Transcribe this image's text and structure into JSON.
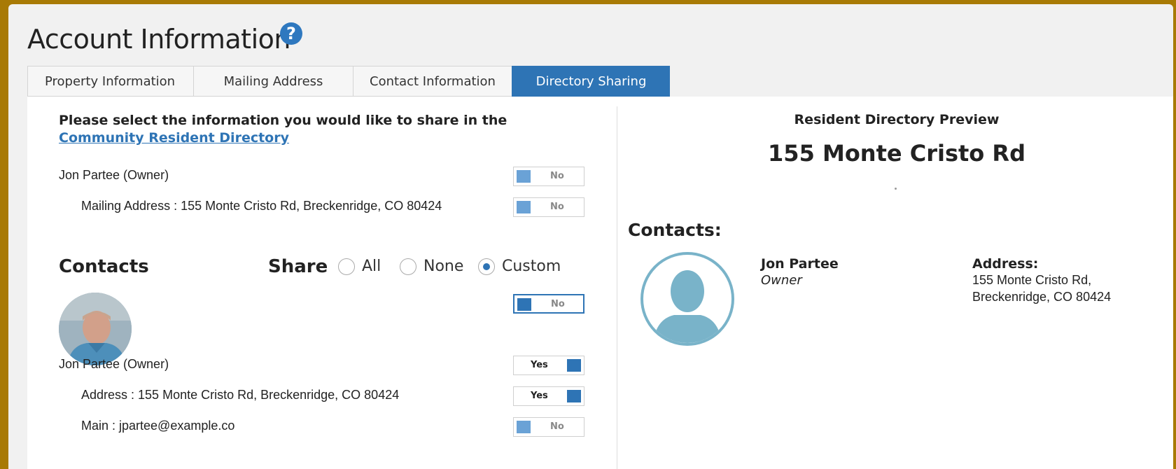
{
  "page": {
    "title": "Account Information",
    "help_icon": "?"
  },
  "tabs": [
    {
      "label": "Property Information",
      "active": false
    },
    {
      "label": "Mailing Address",
      "active": false
    },
    {
      "label": "Contact Information",
      "active": false
    },
    {
      "label": "Directory Sharing",
      "active": true
    }
  ],
  "left": {
    "intro_text": "Please select the information you would like to share in the ",
    "intro_link": "Community Resident Directory",
    "owner_row": {
      "label": "Jon Partee (Owner)",
      "toggle": "No"
    },
    "mailing_row": {
      "label": "Mailing Address : 155 Monte Cristo Rd, Breckenridge, CO 80424",
      "toggle": "No"
    },
    "contacts_heading": "Contacts",
    "share_heading": "Share",
    "share_options": [
      "All",
      "None",
      "Custom"
    ],
    "share_selected": "Custom",
    "photo_toggle": "No",
    "contact_rows": [
      {
        "label": "Jon Partee (Owner)",
        "toggle": "Yes"
      },
      {
        "label": "Address : 155 Monte Cristo Rd, Breckenridge, CO 80424",
        "toggle": "Yes"
      },
      {
        "label": "Main : jpartee@example.co",
        "toggle": "No"
      }
    ]
  },
  "preview": {
    "heading": "Resident Directory Preview",
    "address": "155 Monte Cristo Rd",
    "contacts_heading": "Contacts:",
    "contact_name": "Jon Partee",
    "contact_role": "Owner",
    "address_label": "Address:",
    "address_line1": "155 Monte Cristo Rd,",
    "address_line2": "Breckenridge, CO 80424"
  },
  "colors": {
    "accent": "#2e74b5",
    "frame": "#a87a05",
    "avatar_outline": "#79b3c9"
  }
}
